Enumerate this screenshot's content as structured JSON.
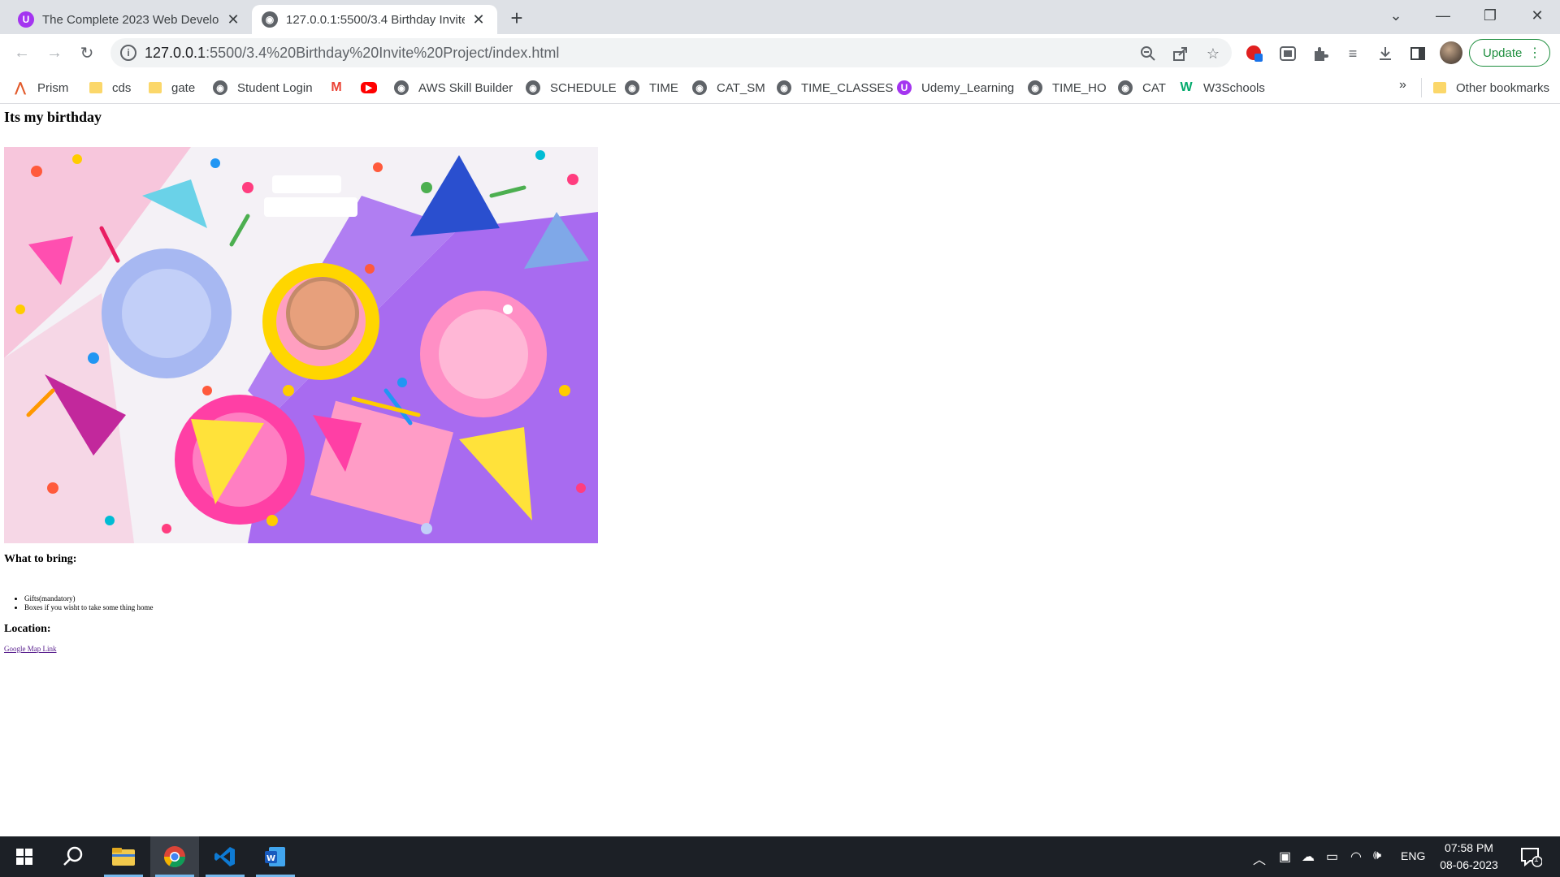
{
  "browser": {
    "tabs": [
      {
        "title": "The Complete 2023 Web Develop",
        "favicon": "udemy-icon",
        "active": false
      },
      {
        "title": "127.0.0.1:5500/3.4 Birthday Invite",
        "favicon": "globe-icon",
        "active": true
      }
    ],
    "address_bar": {
      "host": "127.0.0.1",
      "path": ":5500/3.4%20Birthday%20Invite%20Project/index.html"
    },
    "update_button": "Update",
    "bookmarks": [
      {
        "label": "Prism",
        "icon": "prism-icon"
      },
      {
        "label": "cds",
        "icon": "folder-icon"
      },
      {
        "label": "gate",
        "icon": "folder-icon"
      },
      {
        "label": "Student Login",
        "icon": "globe-icon"
      },
      {
        "label": "",
        "icon": "gmail-icon"
      },
      {
        "label": "",
        "icon": "youtube-icon"
      },
      {
        "label": "AWS Skill Builder",
        "icon": "globe-icon"
      },
      {
        "label": "SCHEDULE",
        "icon": "globe-icon"
      },
      {
        "label": "TIME",
        "icon": "globe-icon"
      },
      {
        "label": "CAT_SM",
        "icon": "globe-icon"
      },
      {
        "label": "TIME_CLASSES",
        "icon": "globe-icon"
      },
      {
        "label": "Udemy_Learning",
        "icon": "udemy-icon"
      },
      {
        "label": "TIME_HO",
        "icon": "globe-icon"
      },
      {
        "label": "CAT",
        "icon": "globe-icon"
      },
      {
        "label": "W3Schools",
        "icon": "w3schools-icon"
      }
    ],
    "overflow": "»",
    "other_bookmarks": "Other bookmarks"
  },
  "page": {
    "heading": "Its my birthday",
    "image_alt": "party-image",
    "bring_heading": "What to bring:",
    "bring_items": [
      "Gifts(mandatory)",
      "Boxes if you wisht to take some thing home"
    ],
    "location_heading": "Location:",
    "map_link": "Google Map Link"
  },
  "taskbar": {
    "apps": [
      "windows-start",
      "search",
      "file-explorer",
      "chrome",
      "vscode",
      "word"
    ],
    "language": "ENG",
    "time": "07:58 PM",
    "date": "08-06-2023",
    "notification_count": "1"
  },
  "colors": {
    "tabstrip": "#dee1e6",
    "omnibox": "#f1f3f4",
    "accent_green": "#1e8e3e",
    "taskbar": "#1c2026",
    "link_visited": "#551a8b"
  }
}
